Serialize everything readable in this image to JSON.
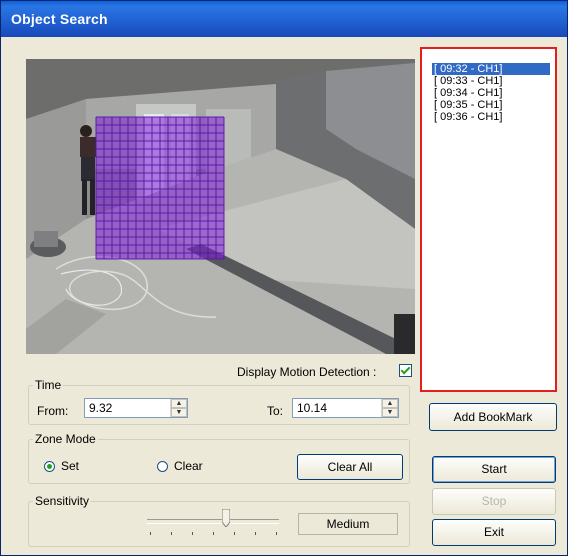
{
  "window": {
    "title": "Object Search"
  },
  "bookmarks": {
    "items": [
      {
        "label": "[ 09:32 - CH1]",
        "selected": true
      },
      {
        "label": "[ 09:33 - CH1]",
        "selected": false
      },
      {
        "label": "[ 09:34 - CH1]",
        "selected": false
      },
      {
        "label": "[ 09:35 - CH1]",
        "selected": false
      },
      {
        "label": "[ 09:36 - CH1]",
        "selected": false
      }
    ]
  },
  "motion": {
    "label": "Display Motion Detection :",
    "checked": true
  },
  "time": {
    "legend": "Time",
    "from_label": "From:",
    "from_value": "9.32",
    "to_label": "To:",
    "to_value": "10.14"
  },
  "zone": {
    "legend": "Zone Mode",
    "set_label": "Set",
    "clear_label": "Clear",
    "selected": "Set",
    "clear_all_label": "Clear All"
  },
  "sensitivity": {
    "legend": "Sensitivity",
    "value_label": "Medium",
    "level": 0.6
  },
  "actions": {
    "add_bookmark_label": "Add BookMark",
    "start_label": "Start",
    "stop_label": "Stop",
    "exit_label": "Exit"
  },
  "colors": {
    "highlight_border": "#e21e1e",
    "motion_grid": "#7a1fd1",
    "selection": "#316ac5"
  }
}
